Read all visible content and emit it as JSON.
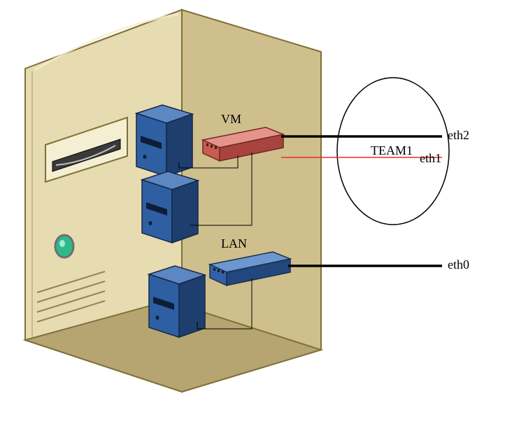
{
  "labels": {
    "vm": "VM",
    "lan": "LAN",
    "team": "TEAM1",
    "eth2": "eth2",
    "eth1": "eth1",
    "eth0": "eth0"
  },
  "colors": {
    "server_light": "#E7DBB1",
    "server_mid": "#D6C58A",
    "server_dark": "#9F8E5B",
    "server_outline": "#7F7038",
    "vm_blue_light": "#4D7BBA",
    "vm_blue_mid": "#2F5FA3",
    "vm_blue_dark": "#1E3E6E",
    "vm_outline": "#132846",
    "switch_red_light": "#E07E72",
    "switch_red_mid": "#C95B52",
    "switch_red_dark": "#9B3E38",
    "switch_blue_light": "#4E7EC4",
    "switch_blue_mid": "#3361A7",
    "switch_blue_dark": "#1F3E6E",
    "led_green": "#2FB98A",
    "led_ring": "#6F6F6F",
    "eth1_line": "#EF2B2B"
  }
}
